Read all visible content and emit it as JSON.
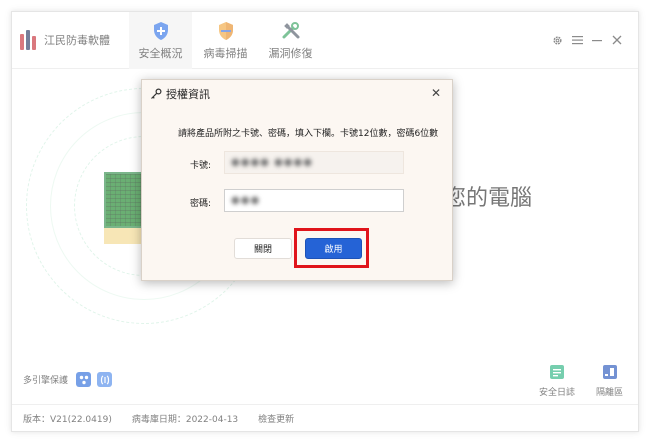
{
  "app": {
    "name": "江民防毒軟體",
    "colors": {
      "accent": "#2563d6",
      "highlight": "#e0141b",
      "logo_red": "#c3262f",
      "logo_navy": "#1f2f5c"
    }
  },
  "nav": {
    "tabs": [
      {
        "label": "安全概況",
        "icon": "shield-plus-icon",
        "active": true
      },
      {
        "label": "病毒掃描",
        "icon": "scan-shield-icon",
        "active": false
      },
      {
        "label": "漏洞修復",
        "icon": "tools-icon",
        "active": false
      }
    ]
  },
  "window_controls": [
    "gear-icon",
    "menu-icon",
    "minimize-icon",
    "close-icon"
  ],
  "main": {
    "hero_text": "您的電腦",
    "engine_label": "多引擎保護",
    "tools": [
      {
        "label": "安全日誌",
        "icon": "log-icon"
      },
      {
        "label": "隔離區",
        "icon": "quarantine-icon"
      }
    ]
  },
  "statusbar": {
    "version": "版本：V21(22.0419)",
    "virus_db_date": "病毒庫日期：2022-04-13",
    "check_update": "檢查更新"
  },
  "dialog": {
    "title": "授權資訊",
    "instruction": "請將產品所附之卡號、密碼，填入下欄。卡號12位數，密碼6位數",
    "card_label": "卡號:",
    "card_value": "●●●● ●●●●",
    "password_label": "密碼:",
    "password_value": "●●●",
    "close_label": "關閉",
    "activate_label": "啟用"
  }
}
